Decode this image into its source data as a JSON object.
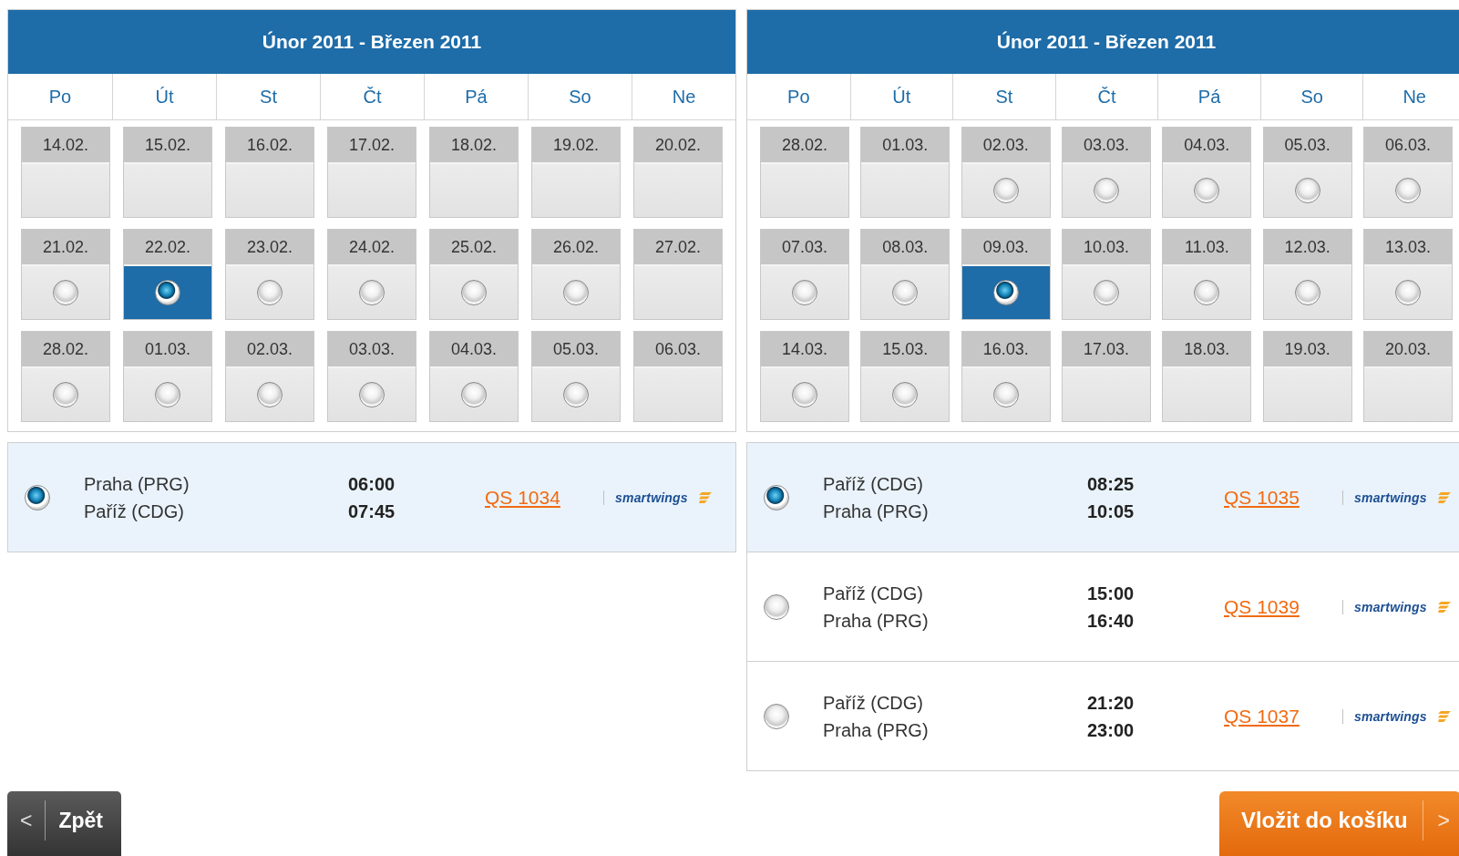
{
  "calendars": [
    {
      "title": "Únor 2011 - Březen 2011",
      "weekdays": [
        "Po",
        "Út",
        "St",
        "Čt",
        "Pá",
        "So",
        "Ne"
      ],
      "weeks": [
        [
          {
            "date": "14.02.",
            "available": false,
            "selected": false
          },
          {
            "date": "15.02.",
            "available": false,
            "selected": false
          },
          {
            "date": "16.02.",
            "available": false,
            "selected": false
          },
          {
            "date": "17.02.",
            "available": false,
            "selected": false
          },
          {
            "date": "18.02.",
            "available": false,
            "selected": false
          },
          {
            "date": "19.02.",
            "available": false,
            "selected": false
          },
          {
            "date": "20.02.",
            "available": false,
            "selected": false
          }
        ],
        [
          {
            "date": "21.02.",
            "available": true,
            "selected": false
          },
          {
            "date": "22.02.",
            "available": true,
            "selected": true
          },
          {
            "date": "23.02.",
            "available": true,
            "selected": false
          },
          {
            "date": "24.02.",
            "available": true,
            "selected": false
          },
          {
            "date": "25.02.",
            "available": true,
            "selected": false
          },
          {
            "date": "26.02.",
            "available": true,
            "selected": false
          },
          {
            "date": "27.02.",
            "available": false,
            "selected": false
          }
        ],
        [
          {
            "date": "28.02.",
            "available": true,
            "selected": false
          },
          {
            "date": "01.03.",
            "available": true,
            "selected": false
          },
          {
            "date": "02.03.",
            "available": true,
            "selected": false
          },
          {
            "date": "03.03.",
            "available": true,
            "selected": false
          },
          {
            "date": "04.03.",
            "available": true,
            "selected": false
          },
          {
            "date": "05.03.",
            "available": true,
            "selected": false
          },
          {
            "date": "06.03.",
            "available": false,
            "selected": false
          }
        ]
      ],
      "flights": [
        {
          "selected": true,
          "from": "Praha (PRG)",
          "to": "Paříž (CDG)",
          "departure": "06:00",
          "arrival": "07:45",
          "flight": "QS 1034",
          "airline": "smartwings"
        }
      ]
    },
    {
      "title": "Únor 2011 - Březen 2011",
      "weekdays": [
        "Po",
        "Út",
        "St",
        "Čt",
        "Pá",
        "So",
        "Ne"
      ],
      "weeks": [
        [
          {
            "date": "28.02.",
            "available": false,
            "selected": false
          },
          {
            "date": "01.03.",
            "available": false,
            "selected": false
          },
          {
            "date": "02.03.",
            "available": true,
            "selected": false
          },
          {
            "date": "03.03.",
            "available": true,
            "selected": false
          },
          {
            "date": "04.03.",
            "available": true,
            "selected": false
          },
          {
            "date": "05.03.",
            "available": true,
            "selected": false
          },
          {
            "date": "06.03.",
            "available": true,
            "selected": false
          }
        ],
        [
          {
            "date": "07.03.",
            "available": true,
            "selected": false
          },
          {
            "date": "08.03.",
            "available": true,
            "selected": false
          },
          {
            "date": "09.03.",
            "available": true,
            "selected": true
          },
          {
            "date": "10.03.",
            "available": true,
            "selected": false
          },
          {
            "date": "11.03.",
            "available": true,
            "selected": false
          },
          {
            "date": "12.03.",
            "available": true,
            "selected": false
          },
          {
            "date": "13.03.",
            "available": true,
            "selected": false
          }
        ],
        [
          {
            "date": "14.03.",
            "available": true,
            "selected": false
          },
          {
            "date": "15.03.",
            "available": true,
            "selected": false
          },
          {
            "date": "16.03.",
            "available": true,
            "selected": false
          },
          {
            "date": "17.03.",
            "available": false,
            "selected": false
          },
          {
            "date": "18.03.",
            "available": false,
            "selected": false
          },
          {
            "date": "19.03.",
            "available": false,
            "selected": false
          },
          {
            "date": "20.03.",
            "available": false,
            "selected": false
          }
        ]
      ],
      "flights": [
        {
          "selected": true,
          "from": "Paříž (CDG)",
          "to": "Praha (PRG)",
          "departure": "08:25",
          "arrival": "10:05",
          "flight": "QS 1035",
          "airline": "smartwings"
        },
        {
          "selected": false,
          "from": "Paříž (CDG)",
          "to": "Praha (PRG)",
          "departure": "15:00",
          "arrival": "16:40",
          "flight": "QS 1039",
          "airline": "smartwings"
        },
        {
          "selected": false,
          "from": "Paříž (CDG)",
          "to": "Praha (PRG)",
          "departure": "21:20",
          "arrival": "23:00",
          "flight": "QS 1037",
          "airline": "smartwings"
        }
      ]
    }
  ],
  "back_button": {
    "arrow": "<",
    "label": "Zpět"
  },
  "cart_button": {
    "label": "Vložit do košíku",
    "arrow": ">"
  }
}
